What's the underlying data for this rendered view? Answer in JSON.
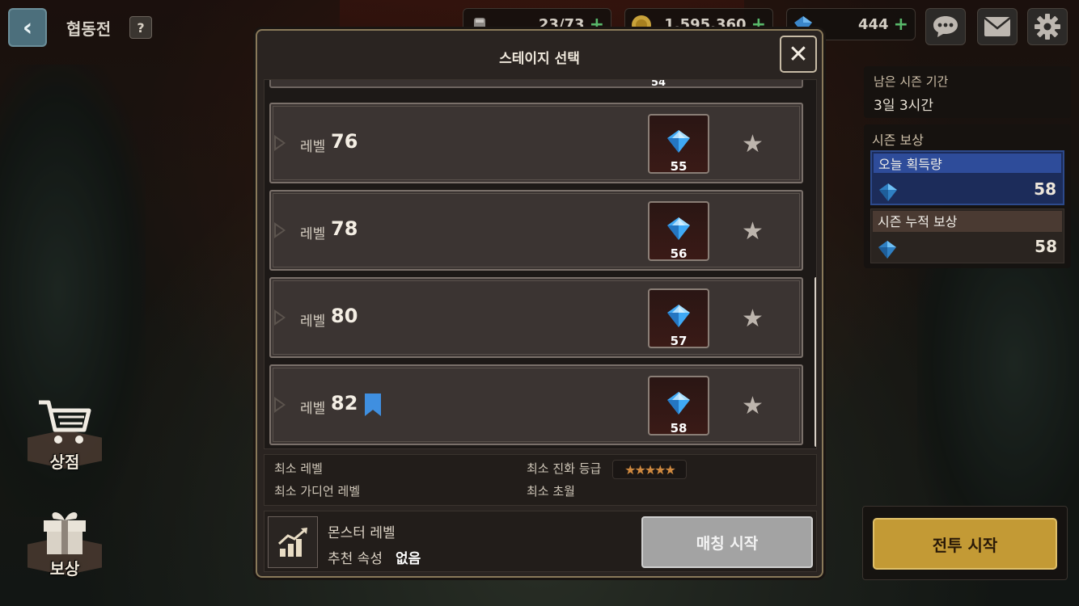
{
  "top_bar": {
    "back_glyph": "‹",
    "title": "협동전",
    "help_glyph": "?",
    "resources": [
      {
        "icon": "stamina-icon",
        "value": "23/73",
        "plus": "+"
      },
      {
        "icon": "gold-coin-icon",
        "value": "1,595,360",
        "plus": "+"
      },
      {
        "icon": "gem-icon",
        "value": "444",
        "plus": "+"
      }
    ],
    "icons": [
      "chat-icon",
      "mail-icon",
      "settings-icon"
    ]
  },
  "dialog": {
    "title": "스테이지 선택",
    "close_glyph": "✕",
    "partial_row_value": "54",
    "stages": [
      {
        "label": "레벨",
        "level": "76",
        "reward": "55",
        "bookmarked": false
      },
      {
        "label": "레벨",
        "level": "78",
        "reward": "56",
        "bookmarked": false
      },
      {
        "label": "레벨",
        "level": "80",
        "reward": "57",
        "bookmarked": false
      },
      {
        "label": "레벨",
        "level": "82",
        "reward": "58",
        "bookmarked": true
      }
    ],
    "star_glyph": "★",
    "requirements": {
      "min_level": "최소 레벨",
      "min_guardian_level": "최소 가디언 레벨",
      "min_evolution": "최소 진화 등급",
      "evolution_stars": "★★★★★",
      "min_transcend": "최소 초월"
    },
    "monster_level_label": "몬스터 레벨",
    "recommended_attr_label": "추천 속성",
    "recommended_attr_value": "없음",
    "match_button": "매칭 시작"
  },
  "right_panel": {
    "season_remaining_label": "남은 시즌 기간",
    "season_remaining_value": "3일 3시간",
    "season_reward_title": "시즌 보상",
    "today_label": "오늘 획득량",
    "today_value": "58",
    "cumulative_label": "시즌 누적 보상",
    "cumulative_value": "58",
    "battle_button": "전투 시작"
  },
  "side_menu": {
    "shop_label": "상점",
    "reward_label": "보상"
  },
  "colors": {
    "accent_gold": "#c39a35",
    "today_blue": "#2e4c9a",
    "bookmark_blue": "#3f8fe0",
    "gem_blue": "#3fa9f5"
  }
}
